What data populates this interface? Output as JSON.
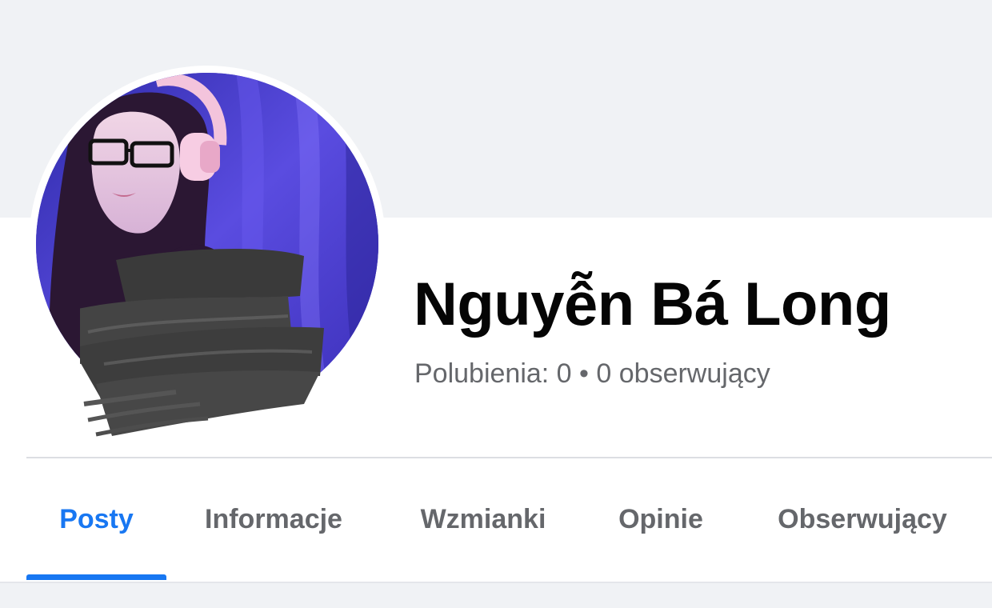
{
  "profile": {
    "name": "Nguyễn Bá Long",
    "stats": "Polubienia: 0 • 0 obserwujący"
  },
  "tabs": [
    {
      "label": "Posty",
      "active": true
    },
    {
      "label": "Informacje",
      "active": false
    },
    {
      "label": "Wzmianki",
      "active": false
    },
    {
      "label": "Opinie",
      "active": false
    },
    {
      "label": "Obserwujący",
      "active": false
    }
  ],
  "colors": {
    "accent": "#1877f2",
    "background": "#f0f2f5",
    "text_primary": "#050505",
    "text_secondary": "#65676b"
  }
}
